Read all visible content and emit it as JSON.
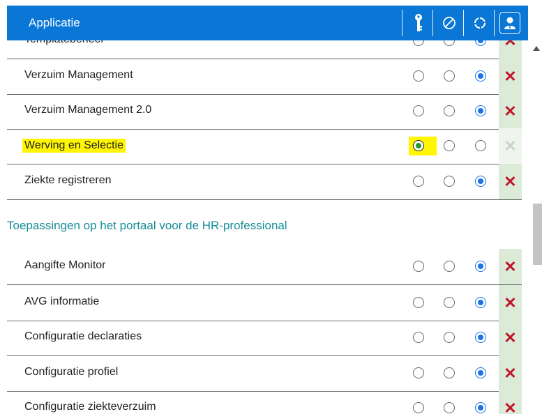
{
  "header": {
    "title": "Applicatie",
    "icons": [
      "key-person-icon",
      "blocked-icon",
      "dashed-circle-icon",
      "user-card-icon"
    ]
  },
  "rows_top": [
    {
      "label": "Templatebeheer",
      "selected": 2,
      "delete_enabled": true,
      "highlighted": false
    },
    {
      "label": "Verzuim Management",
      "selected": 2,
      "delete_enabled": true,
      "highlighted": false
    },
    {
      "label": "Verzuim Management 2.0",
      "selected": 2,
      "delete_enabled": true,
      "highlighted": false
    },
    {
      "label": "Werving en Selectie",
      "selected": 0,
      "delete_enabled": false,
      "highlighted": true
    },
    {
      "label": "Ziekte registreren",
      "selected": 2,
      "delete_enabled": true,
      "highlighted": false
    }
  ],
  "section_title": "Toepassingen op het portaal voor de HR-professional",
  "rows_bottom": [
    {
      "label": "Aangifte Monitor",
      "selected": 2,
      "delete_enabled": true
    },
    {
      "label": "AVG informatie",
      "selected": 2,
      "delete_enabled": true
    },
    {
      "label": "Configuratie declaraties",
      "selected": 2,
      "delete_enabled": true
    },
    {
      "label": "Configuratie profiel",
      "selected": 2,
      "delete_enabled": true
    },
    {
      "label": "Configuratie ziekteverzuim",
      "selected": 2,
      "delete_enabled": true
    }
  ],
  "colors": {
    "header_bg": "#0a77d6",
    "section_title": "#1a8d97",
    "delete_x": "#c0152a",
    "highlight": "#fff600",
    "radio_blue": "#1a73e8",
    "radio_green": "#1e9b2a"
  },
  "delete_glyph": "✕"
}
